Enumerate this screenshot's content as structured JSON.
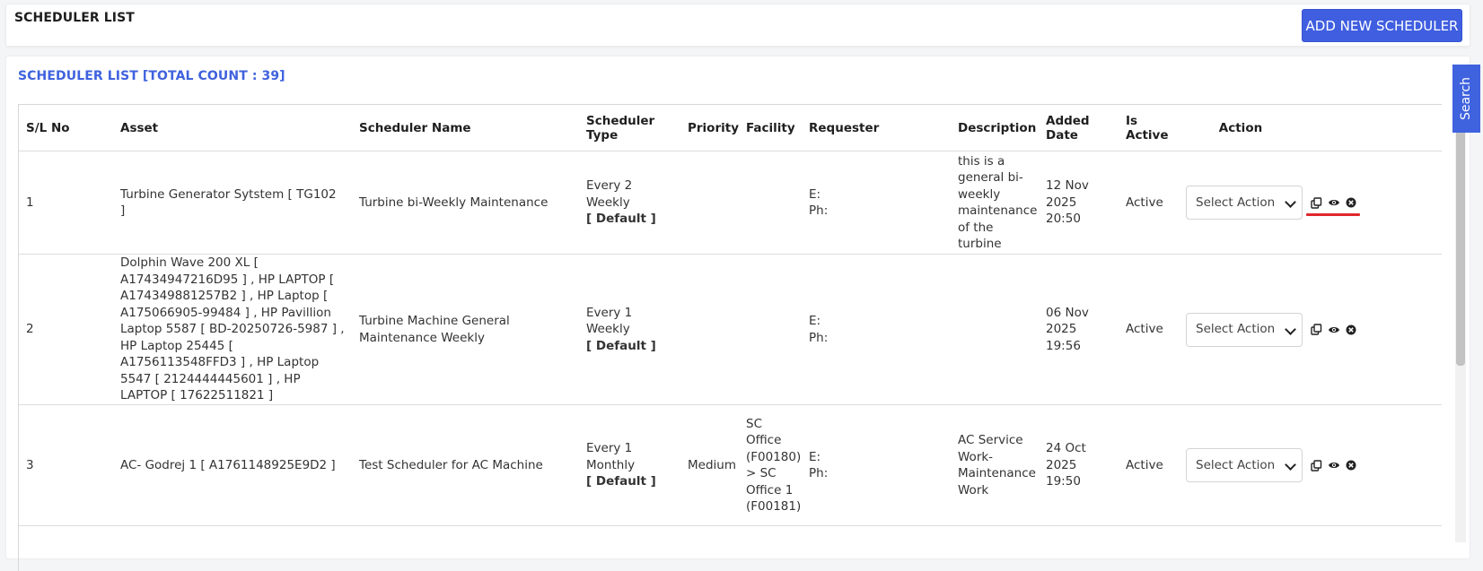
{
  "header": {
    "title": "SCHEDULER LIST",
    "add_button": "ADD NEW SCHEDULER"
  },
  "list": {
    "title": "SCHEDULER LIST [TOTAL COUNT : 39]",
    "columns": [
      "S/L No",
      "Asset",
      "Scheduler Name",
      "Scheduler Type",
      "Priority",
      "Facility",
      "Requester",
      "Description",
      "Added Date",
      "Is Active",
      "Action"
    ],
    "rows": [
      {
        "sl": "1",
        "asset": "Turbine Generator Sytstem [ TG102 ]",
        "name": "Turbine bi-Weekly Maintenance",
        "type": "Every 2   Weekly",
        "type_default": "[ Default ]",
        "priority": "",
        "facility": "",
        "requester_e": "E:",
        "requester_ph": "Ph:",
        "description": "this is a general bi-weekly maintenance of the turbine",
        "added": "12 Nov 2025 20:50",
        "active": "Active",
        "action": "Select Action"
      },
      {
        "sl": "2",
        "asset": "Dolphin Wave 200 XL [ A17434947216D95 ] , HP LAPTOP [ A174349881257B2 ] , HP Laptop [ A175066905-99484 ] , HP Pavillion Laptop 5587 [ BD-20250726-5987 ] , HP Laptop 25445 [ A1756113548FFD3 ] , HP Laptop 5547 [ 2124444445601 ] , HP LAPTOP [ 17622511821 ]",
        "name": "Turbine Machine General Maintenance Weekly",
        "type": "Every 1   Weekly",
        "type_default": "[ Default ]",
        "priority": "",
        "facility": "",
        "requester_e": "E:",
        "requester_ph": "Ph:",
        "description": "",
        "added": "06 Nov 2025 19:56",
        "active": "Active",
        "action": "Select Action"
      },
      {
        "sl": "3",
        "asset": "AC- Godrej 1 [ A1761148925E9D2 ]",
        "name": "Test Scheduler for AC Machine",
        "type": "Every 1   Monthly",
        "type_default": "[ Default ]",
        "priority": "Medium",
        "facility": "SC Office (F00180) > SC Office 1 (F00181)",
        "requester_e": "E:",
        "requester_ph": "Ph:",
        "description": "AC Service Work-Maintenance Work",
        "added": "24 Oct 2025 19:50",
        "active": "Active",
        "action": "Select Action"
      }
    ]
  },
  "side_tab": "Search",
  "icons": [
    "copy-icon",
    "eye-icon",
    "close-circle-icon"
  ],
  "colors": {
    "accent": "#3f5ee0",
    "title_blue": "#3f62de",
    "highlight": "#e0262b"
  }
}
